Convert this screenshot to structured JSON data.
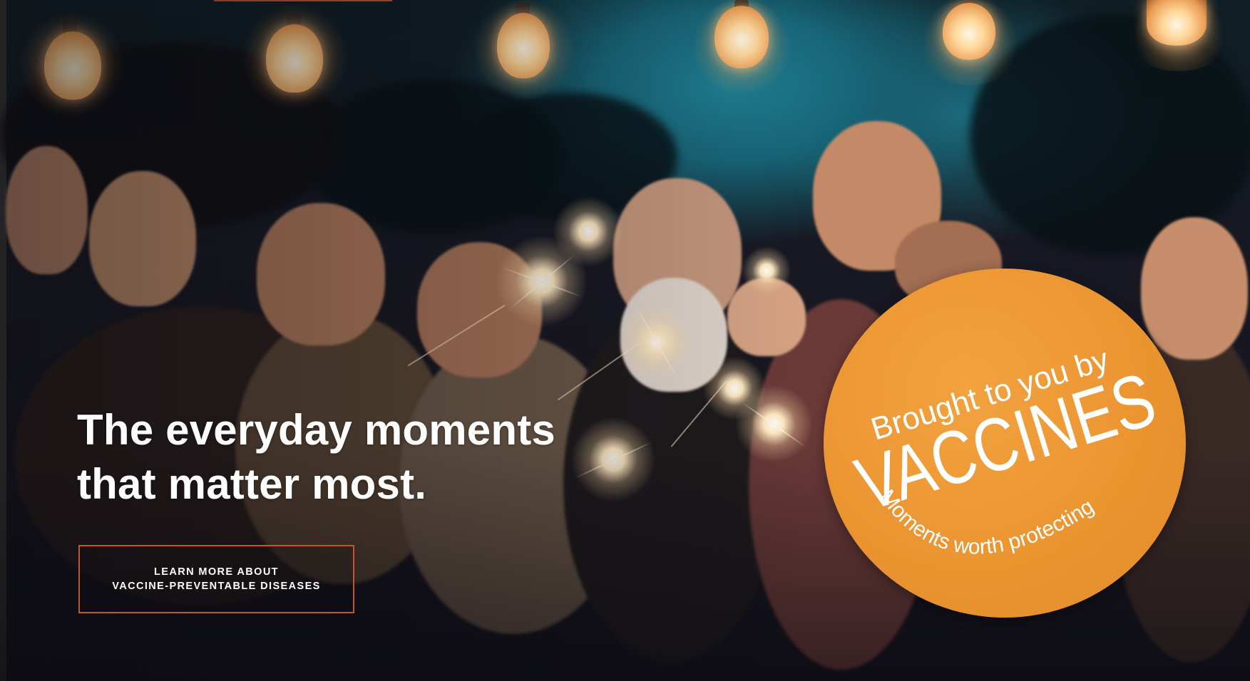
{
  "hero": {
    "headline_line1": "The everyday moments",
    "headline_line2": "that matter most.",
    "cta_line1": "LEARN MORE ABOUT",
    "cta_line2": "VACCINE-PREVENTABLE DISEASES"
  },
  "badge": {
    "line1": "Brought to you by",
    "line2": "VACCINES",
    "line3": "Moments worth protecting."
  },
  "colors": {
    "accent": "#c4562a",
    "badge_orange": "#eb9531",
    "sky_teal": "#1f7f93"
  }
}
